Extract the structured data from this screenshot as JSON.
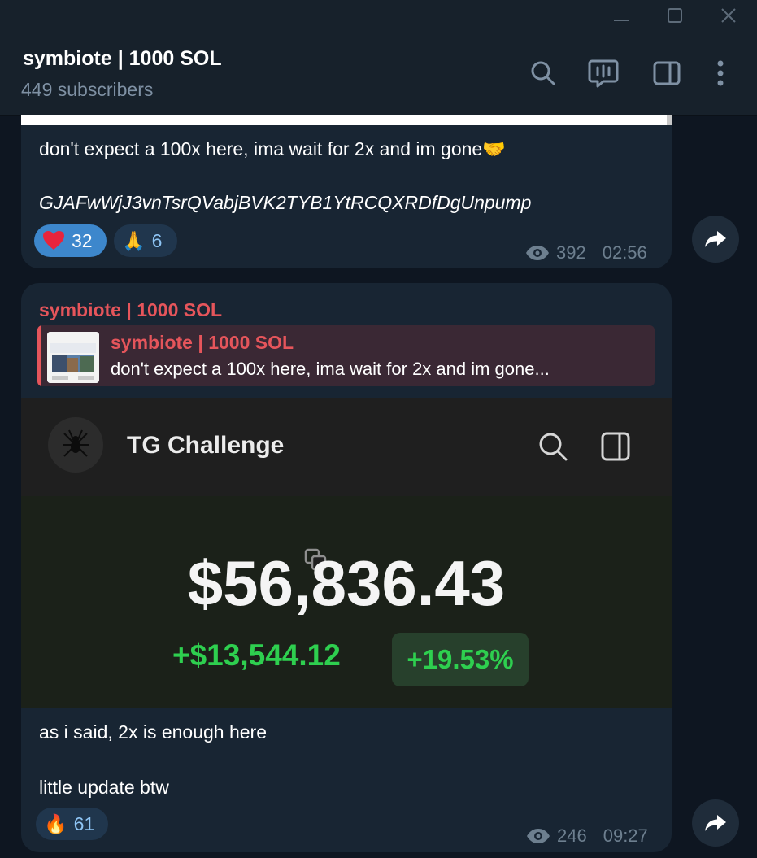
{
  "window": {
    "minimize_icon": "minimize-icon",
    "maximize_icon": "maximize-icon",
    "close_icon": "close-icon"
  },
  "header": {
    "title": "symbiote | 1000 SOL",
    "subscribers": "449 subscribers",
    "icons": [
      "search-icon",
      "live-stream-icon",
      "sidebar-toggle-icon",
      "more-vertical-icon"
    ]
  },
  "messages": [
    {
      "text_line1": "don't expect a 100x here, ima wait for 2x and im gone🤝",
      "text_line2": "GJAFwWjJ3vnTsrQVabjBVK2TYB1YtRCQXRDfDgUnpump",
      "reactions": [
        {
          "emoji": "❤️",
          "count": "32",
          "chosen": true
        },
        {
          "emoji": "🙏",
          "count": "6",
          "chosen": false
        }
      ],
      "views": "392",
      "time": "02:56"
    },
    {
      "author": "symbiote | 1000 SOL",
      "reply": {
        "author": "symbiote | 1000 SOL",
        "text": "don't expect a 100x here, ima wait for 2x and im gone..."
      },
      "screenshot": {
        "title": "TG Challenge",
        "balance": "$56,836.43",
        "change": "+$13,544.12",
        "change_percent": "+19.53%"
      },
      "text_line1": "as i said, 2x is enough here",
      "text_line2": "little update btw",
      "reactions": [
        {
          "emoji": "🔥",
          "count": "61",
          "chosen": false
        }
      ],
      "views": "246",
      "time": "09:27"
    }
  ],
  "colors": {
    "background": "#0e1621",
    "bubble": "#182533",
    "header": "#17212b",
    "author_red": "#e5555b",
    "gain_green": "#2ecf4f"
  }
}
